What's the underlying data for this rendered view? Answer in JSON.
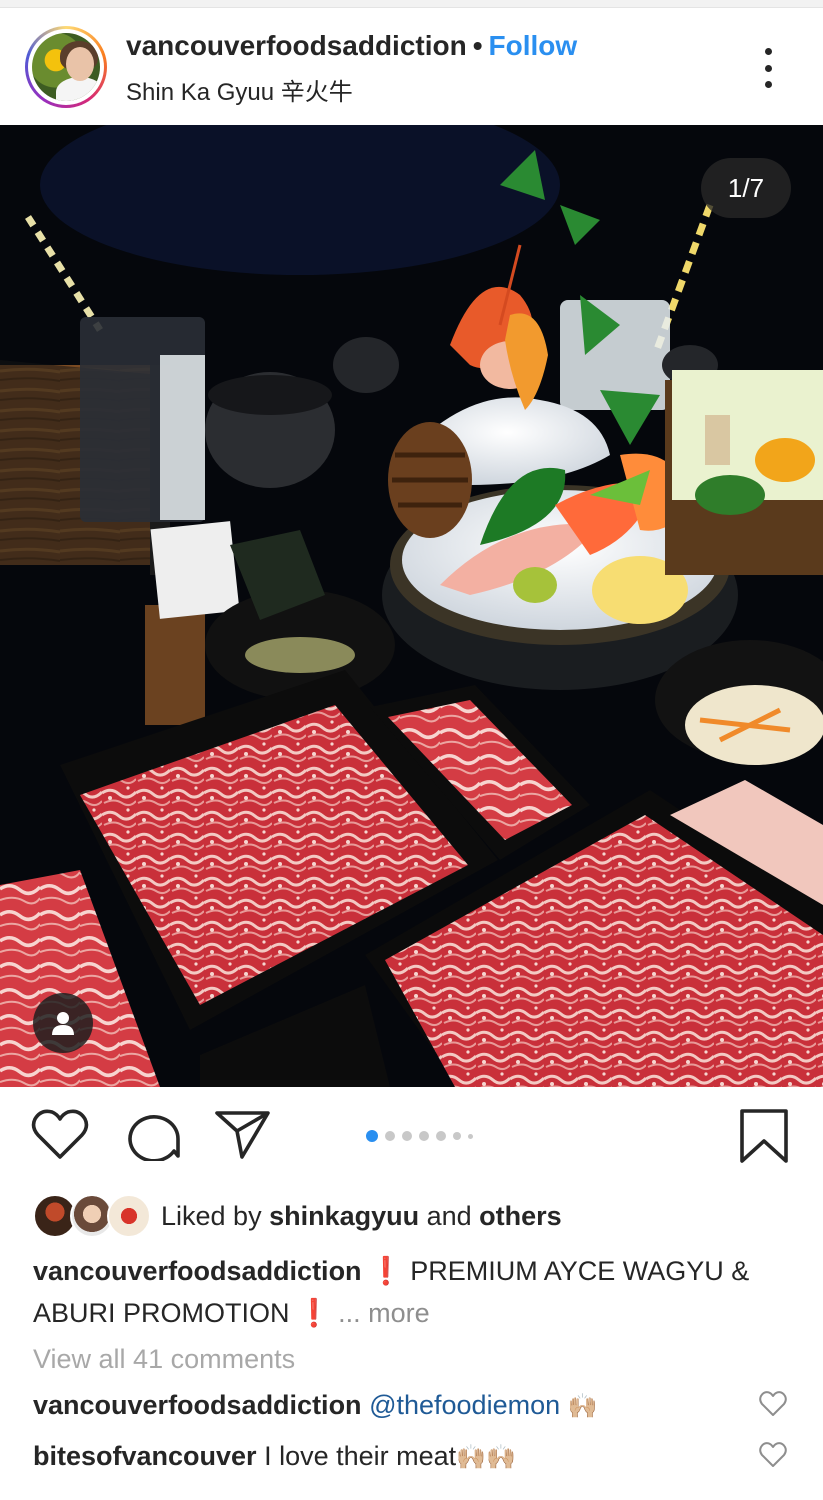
{
  "post": {
    "username": "vancouverfoodsaddiction",
    "separator": "•",
    "follow_label": "Follow",
    "location": "Shin Ka Gyuu 辛火牛",
    "more_icon": "more-vertical-icon",
    "image_counter": "1/7",
    "carousel": {
      "total": 7,
      "current": 1
    }
  },
  "actions": {
    "like_icon": "heart-icon",
    "comment_icon": "comment-icon",
    "share_icon": "send-icon",
    "save_icon": "bookmark-icon"
  },
  "likes": {
    "prefix": "Liked by ",
    "user": "shinkagyuu",
    "middle": " and ",
    "suffix": "others"
  },
  "caption": {
    "username": "vancouverfoodsaddiction",
    "mark1": "❗",
    "text": "PREMIUM AYCE WAGYU & ABURI PROMOTION",
    "mark2": "❗",
    "more": "... more"
  },
  "view_all_comments": "View all 41 comments",
  "comments": [
    {
      "username": "vancouverfoodsaddiction",
      "mention": "@thefoodiemon",
      "text": "",
      "emoji": "🙌🏼"
    },
    {
      "username": "bitesofvancouver",
      "mention": "",
      "text": "I love their meat",
      "emoji": "🙌🏼🙌🏼"
    }
  ],
  "colors": {
    "accent": "#2a8ff0",
    "text": "#262626",
    "muted": "#8e8e8e",
    "active_dot": "#2a8ff0"
  }
}
